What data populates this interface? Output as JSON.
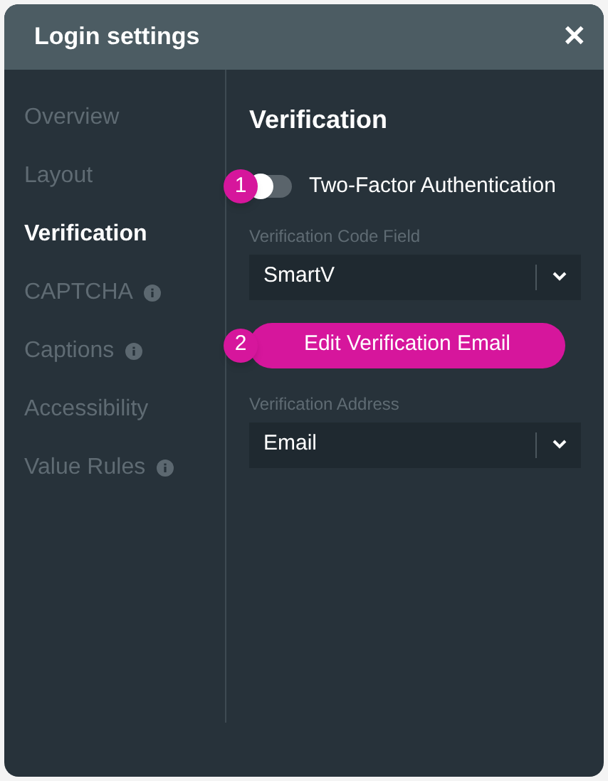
{
  "window": {
    "title": "Login settings",
    "close": "✕"
  },
  "sidebar": {
    "items": [
      {
        "label": "Overview",
        "selected": false,
        "info": false
      },
      {
        "label": "Layout",
        "selected": false,
        "info": false
      },
      {
        "label": "Verification",
        "selected": true,
        "info": false
      },
      {
        "label": "CAPTCHA",
        "selected": false,
        "info": true
      },
      {
        "label": "Captions",
        "selected": false,
        "info": true
      },
      {
        "label": "Accessibility",
        "selected": false,
        "info": false
      },
      {
        "label": "Value Rules",
        "selected": false,
        "info": true
      }
    ]
  },
  "panel": {
    "title": "Verification",
    "fields": [
      {
        "kind": "toggle",
        "badge": "1",
        "label": "Two-Factor Authentication",
        "on": false
      },
      {
        "kind": "select",
        "label": "Verification Code Field",
        "value": "SmartV"
      },
      {
        "kind": "button",
        "badge": "2",
        "label": "Edit Verification Email"
      },
      {
        "kind": "select",
        "label": "Verification Address",
        "value": "Email"
      }
    ]
  }
}
